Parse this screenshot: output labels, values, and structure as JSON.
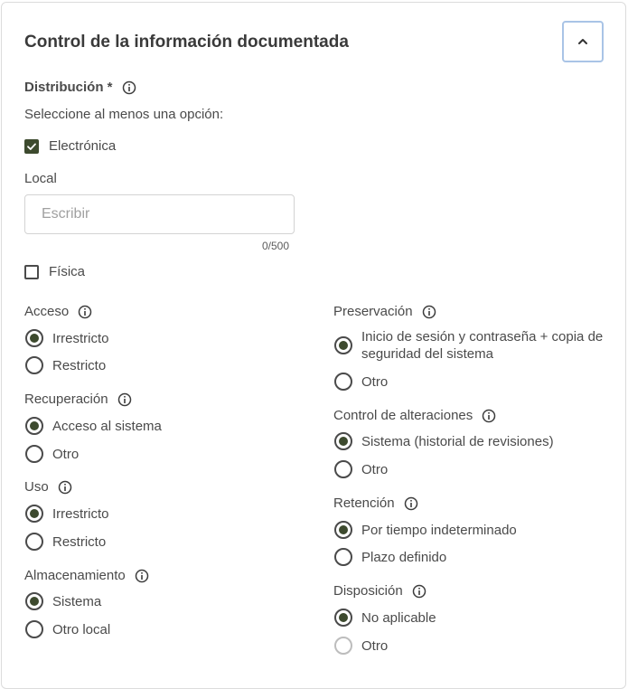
{
  "section": {
    "title": "Control de la información documentada"
  },
  "distribucion": {
    "label": "Distribución *",
    "hint": "Seleccione al menos una opción:",
    "electronica_label": "Electrónica",
    "electronica_checked": true,
    "local_label": "Local",
    "local_placeholder": "Escribir",
    "local_value": "",
    "counter": "0/500",
    "fisica_label": "Física",
    "fisica_checked": false
  },
  "left_groups": [
    {
      "label": "Acceso",
      "options": [
        "Irrestricto",
        "Restricto"
      ],
      "selected": 0
    },
    {
      "label": "Recuperación",
      "options": [
        "Acceso al sistema",
        "Otro"
      ],
      "selected": 0
    },
    {
      "label": "Uso",
      "options": [
        "Irrestricto",
        "Restricto"
      ],
      "selected": 0
    },
    {
      "label": "Almacenamiento",
      "options": [
        "Sistema",
        "Otro local"
      ],
      "selected": 0
    }
  ],
  "right_groups": [
    {
      "label": "Preservación",
      "options": [
        "Inicio de sesión y contraseña + copia de seguridad del sistema",
        "Otro"
      ],
      "selected": 0
    },
    {
      "label": "Control de alteraciones",
      "options": [
        "Sistema (historial de revisiones)",
        "Otro"
      ],
      "selected": 0
    },
    {
      "label": "Retención",
      "options": [
        "Por tiempo indeterminado",
        "Plazo definido"
      ],
      "selected": 0
    },
    {
      "label": "Disposición",
      "options": [
        "No aplicable",
        "Otro"
      ],
      "selected": 0
    }
  ],
  "colors": {
    "accent": "#3d4a2e",
    "focus_border": "#a9c4e6"
  },
  "icons": {
    "collapse": "chevron-up-icon",
    "info": "info-icon",
    "check": "check-icon"
  }
}
